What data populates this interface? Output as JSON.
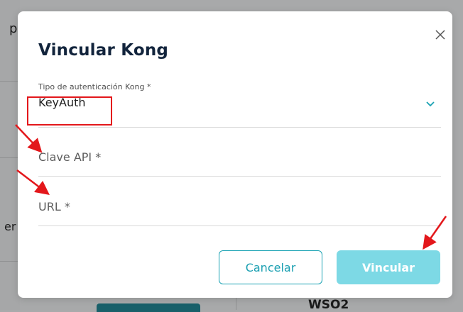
{
  "background": {
    "partial_left_text_top": "p",
    "partial_left_text_mid": "er",
    "partial_right_bottom_text": "WSO2"
  },
  "dialog": {
    "title": "Vincular Kong",
    "close_icon": "close-icon",
    "auth_type_field": {
      "label": "Tipo de autenticación Kong *",
      "value": "KeyAuth",
      "chevron_icon": "chevron-down-icon"
    },
    "api_key_field": {
      "placeholder": "Clave API *"
    },
    "url_field": {
      "placeholder": "URL *"
    },
    "buttons": {
      "cancel": "Cancelar",
      "link": "Vincular"
    }
  },
  "colors": {
    "accent": "#1aa2b3",
    "link_button_bg": "#7dd9e5",
    "annotation_red": "#e3171b",
    "title": "#12243c"
  }
}
